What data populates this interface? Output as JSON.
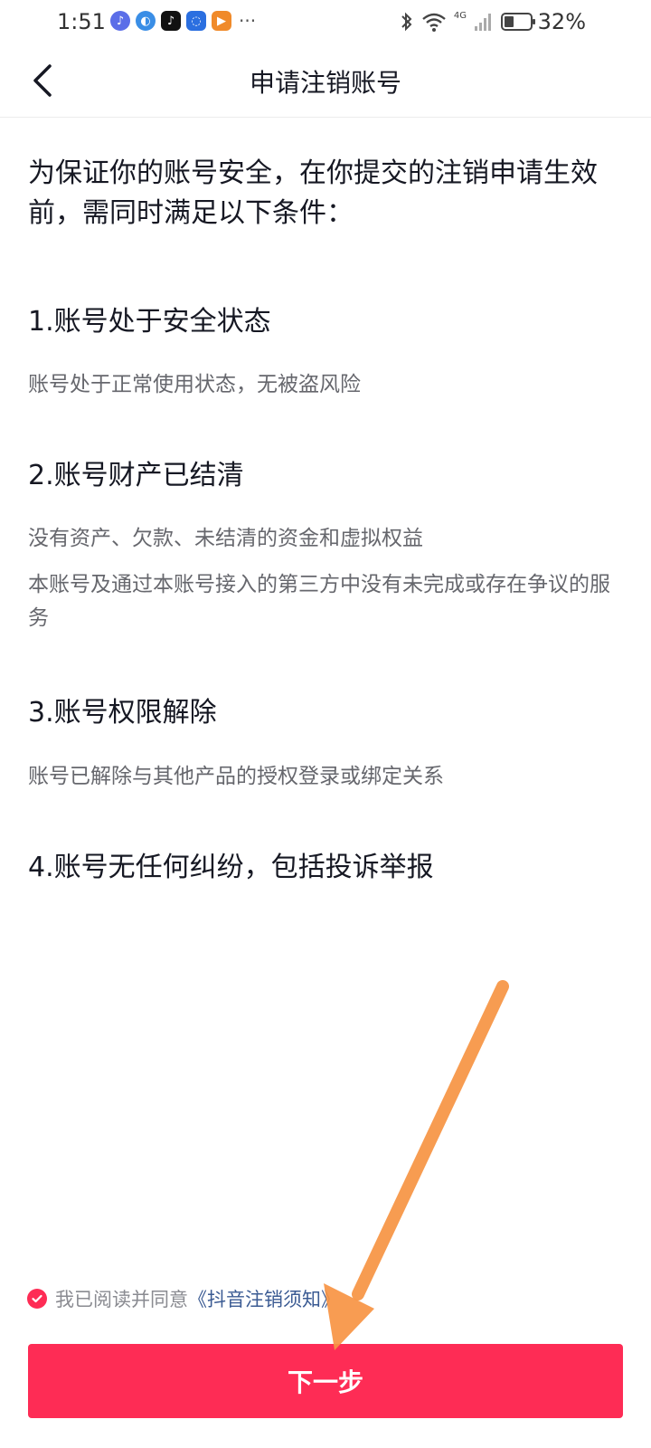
{
  "status_bar": {
    "time": "1:51",
    "network": "4G",
    "battery": "32%"
  },
  "header": {
    "title": "申请注销账号"
  },
  "intro": "为保证你的账号安全，在你提交的注销申请生效前，需同时满足以下条件：",
  "conditions": [
    {
      "title": "1.账号处于安全状态",
      "desc": [
        "账号处于正常使用状态，无被盗风险"
      ]
    },
    {
      "title": "2.账号财产已结清",
      "desc": [
        "没有资产、欠款、未结清的资金和虚拟权益",
        "本账号及通过本账号接入的第三方中没有未完成或存在争议的服务"
      ]
    },
    {
      "title": "3.账号权限解除",
      "desc": [
        "账号已解除与其他产品的授权登录或绑定关系"
      ]
    },
    {
      "title": "4.账号无任何纠纷，包括投诉举报",
      "desc": []
    }
  ],
  "agreement": {
    "checked": true,
    "text": "我已阅读并同意",
    "link": "《抖音注销须知》"
  },
  "next_button": {
    "label": "下一步"
  },
  "colors": {
    "accent": "#fe2c55",
    "link": "#3b5b93",
    "annotation_arrow": "#f79443"
  },
  "icons": {
    "back": "chevron-left-icon",
    "check": "check-circle-icon",
    "arrow": "annotation-arrow"
  }
}
